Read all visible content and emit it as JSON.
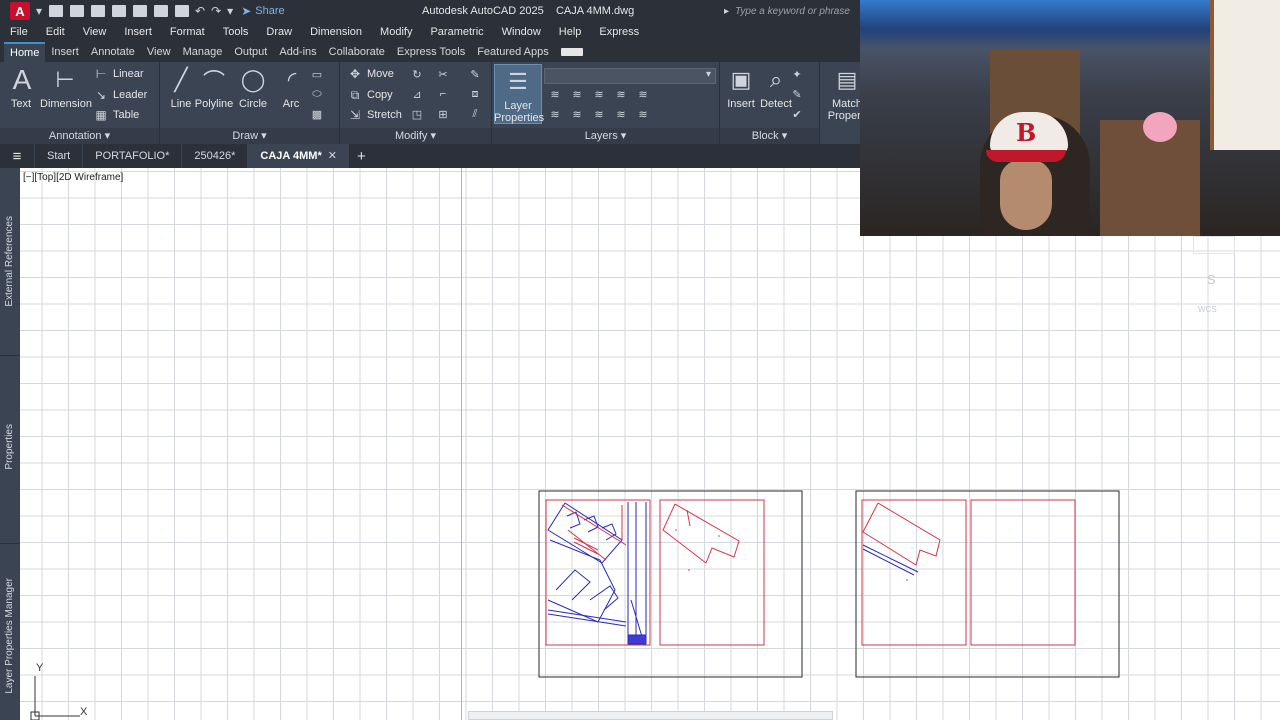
{
  "title": {
    "app_name": "Autodesk AutoCAD 2025",
    "file_name": "CAJA 4MM.dwg",
    "logo_letter": "A",
    "share_label": "Share",
    "search_placeholder": "Type a keyword or phrase"
  },
  "menu": [
    "File",
    "Edit",
    "View",
    "Insert",
    "Format",
    "Tools",
    "Draw",
    "Dimension",
    "Modify",
    "Parametric",
    "Window",
    "Help",
    "Express"
  ],
  "ribbon_tabs": [
    "Home",
    "Insert",
    "Annotate",
    "View",
    "Manage",
    "Output",
    "Add-ins",
    "Collaborate",
    "Express Tools",
    "Featured Apps"
  ],
  "ribbon": {
    "annotation": {
      "title": "Annotation",
      "text": "Text",
      "dimension": "Dimension",
      "linear": "Linear",
      "leader": "Leader",
      "table": "Table"
    },
    "draw": {
      "title": "Draw",
      "line": "Line",
      "polyline": "Polyline",
      "circle": "Circle",
      "arc": "Arc"
    },
    "modify": {
      "title": "Modify",
      "move": "Move",
      "copy": "Copy",
      "stretch": "Stretch"
    },
    "layers": {
      "title": "Layers",
      "layer_properties_1": "Layer",
      "layer_properties_2": "Properties"
    },
    "block": {
      "title": "Block",
      "insert": "Insert",
      "detect": "Detect"
    },
    "properties": {
      "match_1": "Match",
      "match_2": "Properti"
    }
  },
  "file_tabs": [
    {
      "label": "Start",
      "active": false
    },
    {
      "label": "PORTAFOLIO*",
      "active": false
    },
    {
      "label": "250426*",
      "active": false
    },
    {
      "label": "CAJA 4MM*",
      "active": true
    }
  ],
  "side_palettes": [
    "External References",
    "Properties",
    "Layer Properties Manager"
  ],
  "viewport_label": "[−][Top][2D Wireframe]",
  "ucs": {
    "y": "Y",
    "x": "X"
  },
  "navigation": {
    "compass": "S",
    "wcs": "WCS"
  },
  "colors": {
    "ui_dark": "#2b3039",
    "ui_panel": "#3b4453",
    "drawing_red": "#d6344a",
    "drawing_blue": "#2a2ab8",
    "frame_black": "#2a2a2a"
  }
}
